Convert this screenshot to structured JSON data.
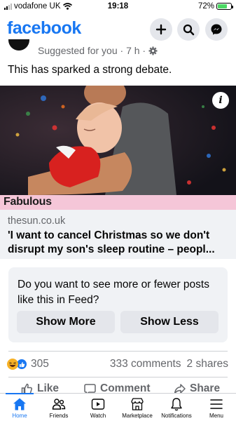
{
  "status_bar": {
    "carrier": "vodafone UK",
    "time": "19:18",
    "battery": "72%",
    "battery_level": 0.72
  },
  "header": {
    "logo": "facebook",
    "icons": [
      "plus-icon",
      "search-icon",
      "messenger-icon"
    ]
  },
  "post": {
    "meta": "Suggested for you · 7 h ·",
    "text": "This has sparked a strong debate.",
    "brand": "Fabulous",
    "link_domain": "thesun.co.uk",
    "link_title": "'I want to cancel Christmas so we don't disrupt my son's sleep routine – peopl..."
  },
  "feedback": {
    "question": "Do you want to see more or fewer posts like this in Feed?",
    "more_label": "Show More",
    "less_label": "Show Less"
  },
  "engagement": {
    "reactions_count": "305",
    "comments": "333 comments",
    "shares": "2 shares"
  },
  "actions": {
    "like": "Like",
    "comment": "Comment",
    "share": "Share"
  },
  "nav": {
    "items": [
      {
        "label": "Home",
        "icon": "home-icon",
        "active": true
      },
      {
        "label": "Friends",
        "icon": "friends-icon"
      },
      {
        "label": "Watch",
        "icon": "watch-icon"
      },
      {
        "label": "Marketplace",
        "icon": "marketplace-icon"
      },
      {
        "label": "Notifications",
        "icon": "bell-icon"
      },
      {
        "label": "Menu",
        "icon": "menu-icon"
      }
    ]
  },
  "colors": {
    "brand_blue": "#1877f2",
    "brand_bar": "#f5c6d8",
    "card_bg": "#f0f2f5",
    "button_bg": "#e4e6eb",
    "secondary_text": "#65676b"
  }
}
